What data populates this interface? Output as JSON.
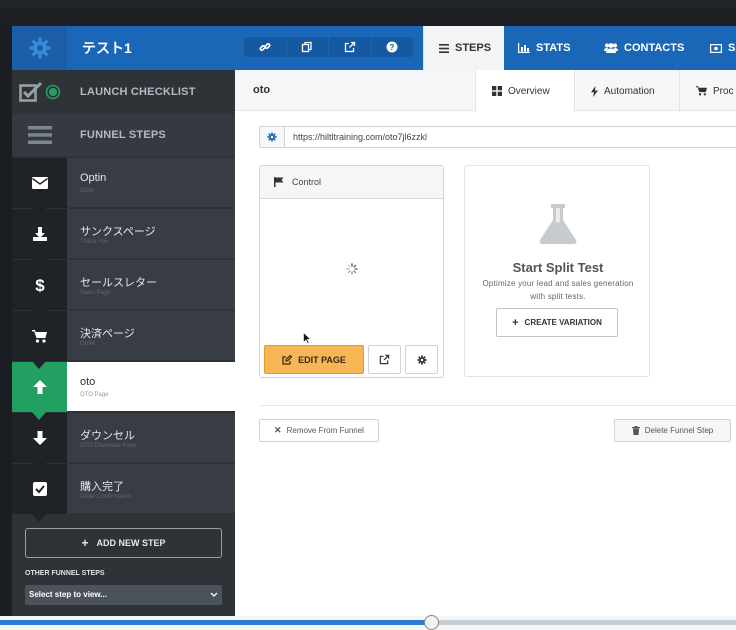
{
  "header": {
    "funnel_name": "テスト1",
    "tabs": [
      {
        "label": "STEPS",
        "icon": "list-icon"
      },
      {
        "label": "STATS",
        "icon": "bar-chart-icon"
      },
      {
        "label": "CONTACTS",
        "icon": "users-icon"
      },
      {
        "label": "SA",
        "icon": "money-icon"
      }
    ],
    "tools": [
      "link-icon",
      "copy-icon",
      "external-link-icon",
      "help-icon"
    ]
  },
  "sidebar": {
    "launch_checklist": "LAUNCH CHECKLIST",
    "funnel_steps": "FUNNEL STEPS",
    "steps": [
      {
        "name": "Optin",
        "sub": "Optin",
        "icon": "envelope-icon"
      },
      {
        "name": "サンクスページ",
        "sub": "Thank You",
        "icon": "download-icon"
      },
      {
        "name": "セールスレター",
        "sub": "Sales Page",
        "icon": "dollar-icon"
      },
      {
        "name": "決済ページ",
        "sub": "Order",
        "icon": "cart-icon"
      },
      {
        "name": "oto",
        "sub": "OTO Page",
        "icon": "arrow-up-icon"
      },
      {
        "name": "ダウンセル",
        "sub": "OTO Downsale Page",
        "icon": "arrow-down-icon"
      },
      {
        "name": "購入完了",
        "sub": "Order Confirmation",
        "icon": "check-square-icon"
      }
    ],
    "add_step": "ADD NEW STEP",
    "other_label": "OTHER FUNNEL STEPS",
    "select_placeholder": "Select step to view..."
  },
  "main": {
    "step_title": "oto",
    "tabs": [
      {
        "label": "Overview",
        "icon": "grid-icon"
      },
      {
        "label": "Automation",
        "icon": "bolt-icon"
      },
      {
        "label": "Proc",
        "icon": "cart-icon"
      }
    ],
    "url": "https://hiltltraining.com/oto7jl6zzkl",
    "control_label": "Control",
    "edit_page": "EDIT PAGE",
    "split_title": "Start Split Test",
    "split_desc": "Optimize your lead and sales generation with split tests.",
    "create_variation": "CREATE VARIATION",
    "remove": "Remove From Funnel",
    "delete": "Delete Funnel Step"
  },
  "video": {
    "progress": 0.585
  },
  "colors": {
    "header_blue": "#1b67b7",
    "sidebar_dark": "#2e3338",
    "active_green": "#22a062",
    "edit_orange": "#f6b655"
  }
}
